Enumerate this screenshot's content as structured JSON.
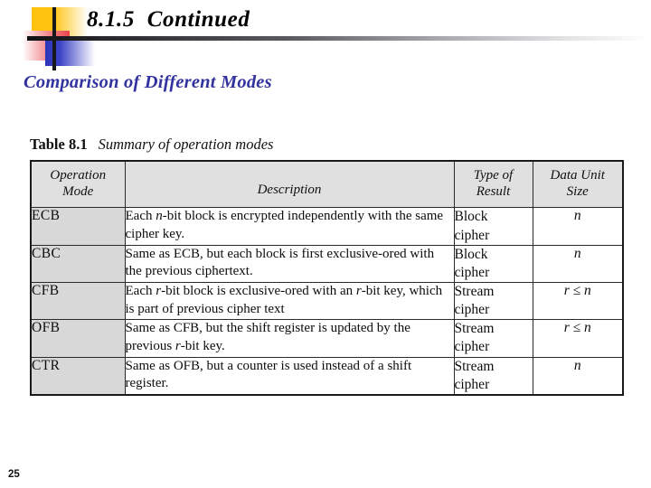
{
  "slide": {
    "title": "8.1.5  Continued",
    "subtitle": "Comparison of Different Modes",
    "page_number": "25",
    "accent_colors": {
      "subtitle": "#3333A0",
      "logo_yellow": "#FFC20E",
      "logo_red": "#E8434A",
      "logo_blue": "#2E34B8",
      "rule_dark": "#111114",
      "table_header_bg": "#e0e0e0",
      "table_mode_bg": "#d8d8d8",
      "table_border": "#1a1a1a"
    }
  },
  "table": {
    "caption_label": "Table 8.1",
    "caption_text": "Summary of operation modes",
    "columns": [
      "Operation\nMode",
      "Description",
      "Type of\nResult",
      "Data Unit\nSize"
    ],
    "columns_flat": {
      "mode_line1": "Operation",
      "mode_line2": "Mode",
      "description": "Description",
      "type_line1": "Type of",
      "type_line2": "Result",
      "size_line1": "Data Unit",
      "size_line2": "Size"
    },
    "rows": [
      {
        "mode": "ECB",
        "description_html": "Each <i>n</i>-bit block is encrypted independently with the same cipher key.",
        "description_text": "Each n-bit block is encrypted independently with the same cipher key.",
        "type_line1": "Block",
        "type_line2": "cipher",
        "size_html": "<i>n</i>",
        "size_text": "n"
      },
      {
        "mode": "CBC",
        "description_html": "Same as ECB, but each block is first exclusive-ored with the previous ciphertext.",
        "description_text": "Same as ECB, but each block is first exclusive-ored with the previous ciphertext.",
        "type_line1": "Block",
        "type_line2": "cipher",
        "size_html": "<i>n</i>",
        "size_text": "n"
      },
      {
        "mode": "CFB",
        "description_html": "Each <i>r</i>-bit block is exclusive-ored with an <i>r</i>-bit key, which is part of previous cipher text",
        "description_text": "Each r-bit block is exclusive-ored with an r-bit key, which is part of previous cipher text",
        "type_line1": "Stream",
        "type_line2": "cipher",
        "size_html": "<i>r</i> ≤ <i>n</i>",
        "size_text": "r ≤ n"
      },
      {
        "mode": "OFB",
        "description_html": "Same as CFB, but the shift register is updated by the previous <i>r</i>-bit key.",
        "description_text": "Same as CFB, but the shift register is updated by the previous r-bit key.",
        "type_line1": "Stream",
        "type_line2": "cipher",
        "size_html": "<i>r</i> ≤ <i>n</i>",
        "size_text": "r ≤ n"
      },
      {
        "mode": "CTR",
        "description_html": "Same as OFB, but a counter is used instead of a shift register.",
        "description_text": "Same as OFB, but a counter is used instead of a shift register.",
        "type_line1": "Stream",
        "type_line2": "cipher",
        "size_html": "<i>n</i>",
        "size_text": "n"
      }
    ]
  }
}
